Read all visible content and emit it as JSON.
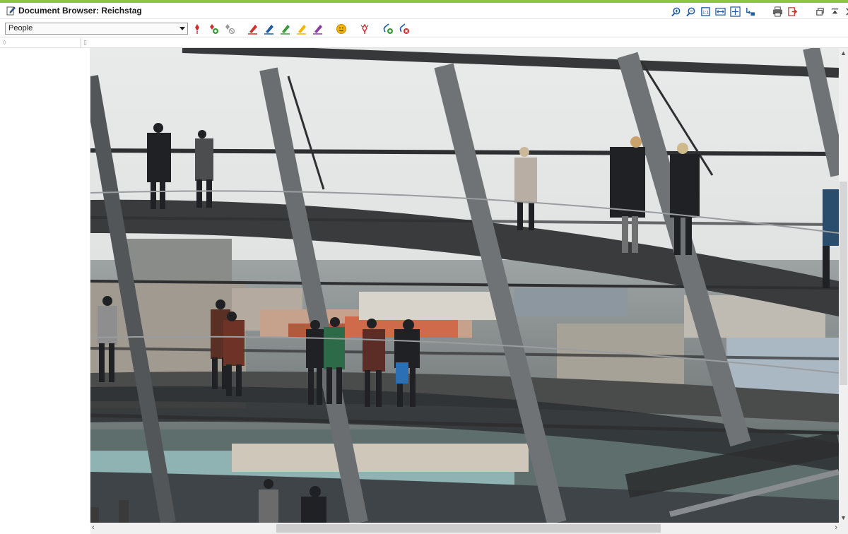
{
  "window": {
    "title": "Document Browser: Reichstag",
    "title_icon": "edit-document-icon",
    "accent_color": "#8cc63f"
  },
  "title_tools": [
    {
      "name": "zoom-in-icon",
      "tooltip": ""
    },
    {
      "name": "zoom-out-icon",
      "tooltip": ""
    },
    {
      "name": "zoom-original-icon",
      "tooltip": ""
    },
    {
      "name": "fit-width-icon",
      "tooltip": ""
    },
    {
      "name": "fit-page-icon",
      "tooltip": ""
    },
    {
      "name": "sync-icon",
      "tooltip": ""
    },
    {
      "name": "print-icon",
      "tooltip": ""
    },
    {
      "name": "export-icon",
      "tooltip": ""
    },
    {
      "name": "restore-window-icon",
      "tooltip": ""
    },
    {
      "name": "maximize-icon",
      "tooltip": ""
    },
    {
      "name": "close-icon",
      "tooltip": ""
    }
  ],
  "toolbar": {
    "code_selector": {
      "value": "People"
    },
    "tools": [
      "code-pin-icon",
      "add-code-icon",
      "code-with-icon",
      "highlighter-red-icon",
      "highlighter-blue-icon",
      "highlighter-green-icon",
      "highlighter-yellow-icon",
      "highlighter-purple-icon",
      "emoticon-icon",
      "link-pin-icon",
      "add-memo-icon",
      "remove-memo-icon"
    ],
    "highlighter_colors": {
      "red": "#d32f2f",
      "blue": "#1e5aa8",
      "green": "#3a9a3a",
      "yellow": "#f2b400",
      "purple": "#8e3ca8"
    }
  },
  "ruler": {
    "left_marker": "◊",
    "mid_marker": "▯"
  },
  "document": {
    "image_alt": "Photo of people walking on the spiral ramp inside the Reichstag glass dome",
    "image_name": "Reichstag"
  }
}
